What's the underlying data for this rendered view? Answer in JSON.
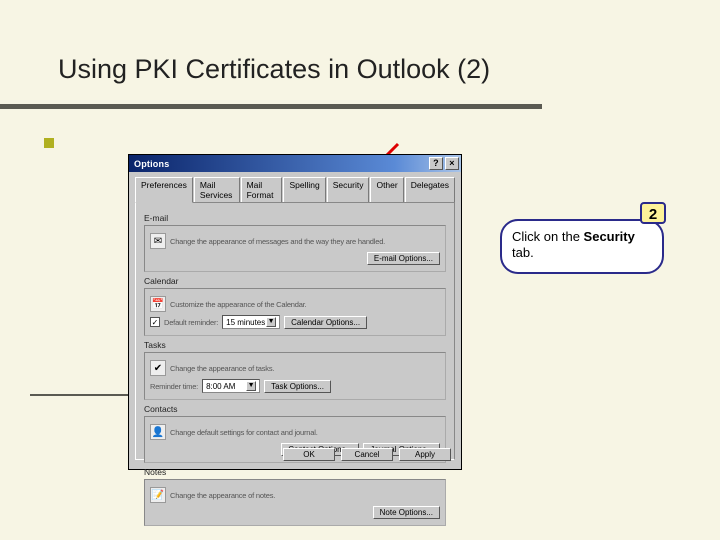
{
  "slide": {
    "title": "Using PKI Certificates in Outlook (2)"
  },
  "callout": {
    "step_number": "2",
    "line1": "Click on the ",
    "bold": "Security",
    "line2": " tab."
  },
  "dialog": {
    "title": "Options",
    "help_btn": "?",
    "close_btn": "×",
    "tabs": {
      "preferences": "Preferences",
      "mail_services": "Mail Services",
      "mail_format": "Mail Format",
      "spelling": "Spelling",
      "security": "Security",
      "other": "Other",
      "delegates": "Delegates"
    },
    "groups": {
      "email": {
        "label": "E-mail",
        "text": "Change the appearance of messages and the way they are handled.",
        "button": "E-mail Options..."
      },
      "calendar": {
        "label": "Calendar",
        "text": "Customize the appearance of the Calendar.",
        "checkbox_label": "Default reminder:",
        "dropdown_value": "15 minutes",
        "button": "Calendar Options..."
      },
      "tasks": {
        "label": "Tasks",
        "text": "Change the appearance of tasks.",
        "field_label": "Reminder time:",
        "dropdown_value": "8:00 AM",
        "button": "Task Options..."
      },
      "contacts": {
        "label": "Contacts",
        "text": "Change default settings for contact and journal.",
        "button1": "Contact Options...",
        "button2": "Journal Options..."
      },
      "notes": {
        "label": "Notes",
        "text": "Change the appearance of notes.",
        "button": "Note Options..."
      }
    },
    "buttons": {
      "ok": "OK",
      "cancel": "Cancel",
      "apply": "Apply"
    }
  }
}
